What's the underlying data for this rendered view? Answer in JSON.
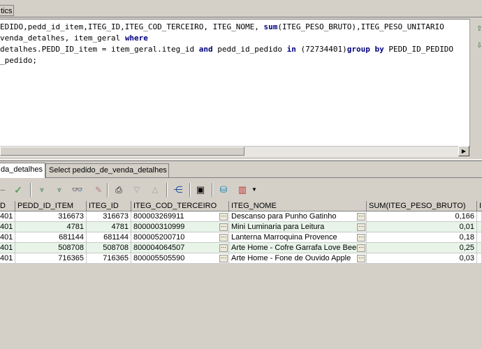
{
  "top_tab": {
    "label": "tics"
  },
  "editor": {
    "lines": [
      [
        {
          "t": "EDIDO,pedd_id_item,ITEG_ID,ITEG_COD_TERCEIRO, ITEG_NOME, ",
          "k": false
        },
        {
          "t": "sum",
          "k": true
        },
        {
          "t": "(ITEG_PESO_BRUTO),ITEG_PESO_UNITARIO",
          "k": false
        }
      ],
      [
        {
          "t": "venda_detalhes, item_geral ",
          "k": false
        },
        {
          "t": "where",
          "k": true
        }
      ],
      [
        {
          "t": "detalhes.PEDD_ID_item = item_geral.iteg_id ",
          "k": false
        },
        {
          "t": "and",
          "k": true
        },
        {
          "t": " pedd_id_pedido ",
          "k": false
        },
        {
          "t": "in",
          "k": true
        },
        {
          "t": " (72734401)",
          "k": false
        },
        {
          "t": "group by",
          "k": true
        },
        {
          "t": " PEDD_ID_PEDIDO",
          "k": false
        }
      ],
      [
        {
          "t": "_pedido;",
          "k": false
        }
      ]
    ]
  },
  "result_tabs": [
    {
      "label": "da_detalhes",
      "active": true
    },
    {
      "label": "Select pedido_de_venda_detalhes",
      "active": false
    }
  ],
  "toolbar": {
    "icons": [
      "minus-icon",
      "check-icon",
      "first-record-icon",
      "last-record-icon",
      "find-icon",
      "clear-icon",
      "print-icon",
      "filter-down-icon",
      "filter-up-icon",
      "tree-icon",
      "save-icon",
      "database-icon",
      "chart-icon",
      "dropdown-arrow-icon"
    ]
  },
  "grid": {
    "headers": [
      "D",
      "PEDD_ID_ITEM",
      "ITEG_ID",
      "ITEG_COD_TERCEIRO",
      "ITEG_NOME",
      "SUM(ITEG_PESO_BRUTO)",
      "I"
    ],
    "rows": [
      [
        "401",
        "316673",
        "316673",
        "800003269911",
        "Descanso para Punho Gatinho",
        "0,166"
      ],
      [
        "401",
        "4781",
        "4781",
        "800000310999",
        "Mini Luminaria para Leitura",
        "0,01"
      ],
      [
        "401",
        "681144",
        "681144",
        "800005200710",
        "Lanterna Marroquina Provence",
        "0,18"
      ],
      [
        "401",
        "508708",
        "508708",
        "800004064507",
        "Arte Home - Cofre Garrafa Love Beer",
        "0,25"
      ],
      [
        "401",
        "716365",
        "716365",
        "800005505590",
        "Arte Home - Fone de Ouvido Apple",
        "0,03"
      ]
    ]
  }
}
